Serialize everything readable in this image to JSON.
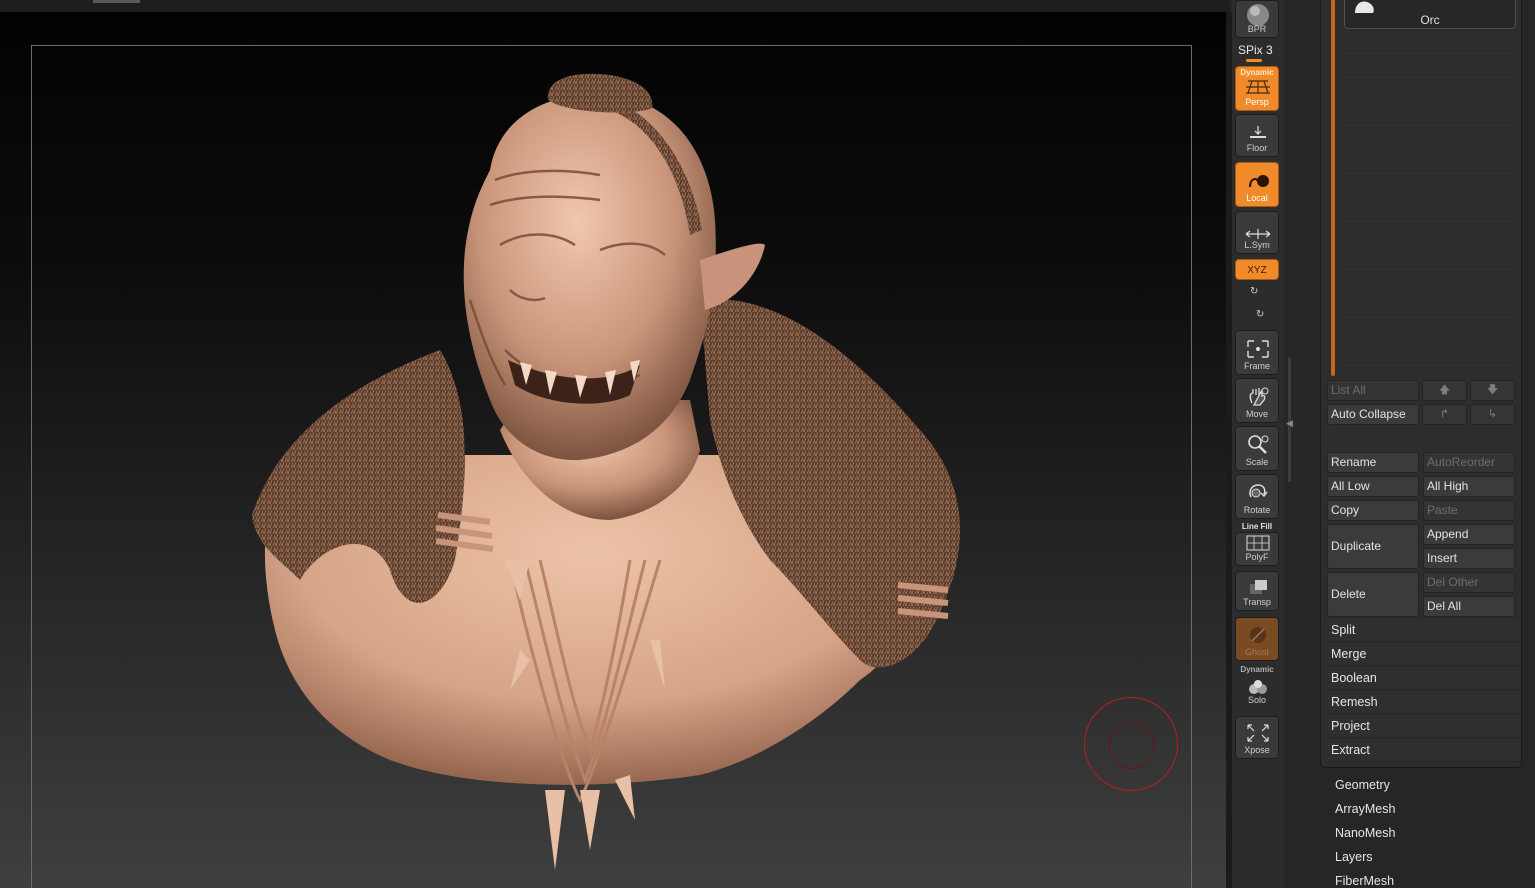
{
  "shelf": {
    "bpr": "BPR",
    "spix": "SPix 3",
    "persp_top": "Dynamic",
    "persp": "Persp",
    "floor": "Floor",
    "local": "Local",
    "lsym": "L.Sym",
    "xyz": "XYZ",
    "frame": "Frame",
    "move": "Move",
    "scale": "Scale",
    "rotate": "Rotate",
    "linefill_top": "Line Fill",
    "polyf": "PolyF",
    "transp": "Transp",
    "ghost": "Ghost",
    "solo_top": "Dynamic",
    "solo": "Solo",
    "xpose": "Xpose"
  },
  "subtool": {
    "active_name": "Orc",
    "list_all": "List All",
    "auto_collapse": "Auto Collapse",
    "rename": "Rename",
    "autoreorder": "AutoReorder",
    "all_low": "All Low",
    "all_high": "All High",
    "copy": "Copy",
    "paste": "Paste",
    "duplicate": "Duplicate",
    "append": "Append",
    "insert": "Insert",
    "delete": "Delete",
    "del_other": "Del Other",
    "del_all": "Del All",
    "sections": [
      "Split",
      "Merge",
      "Boolean",
      "Remesh",
      "Project",
      "Extract"
    ]
  },
  "menus": [
    "Geometry",
    "ArrayMesh",
    "NanoMesh",
    "Layers",
    "FiberMesh"
  ],
  "colors": {
    "accent": "#f08a2a",
    "skin": "#d9a88c",
    "cursor": "#b51f1f"
  }
}
